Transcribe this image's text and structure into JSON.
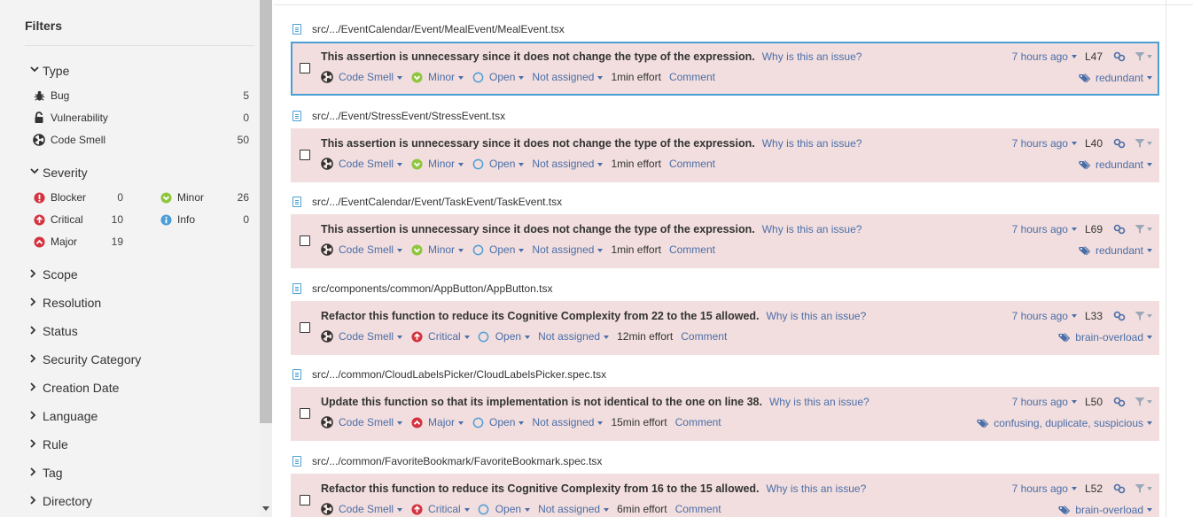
{
  "sidebar": {
    "title": "Filters",
    "type": {
      "label": "Type",
      "items": [
        {
          "label": "Bug",
          "count": "5",
          "icon": "bug-icon"
        },
        {
          "label": "Vulnerability",
          "count": "0",
          "icon": "lock-icon"
        },
        {
          "label": "Code Smell",
          "count": "50",
          "icon": "code-smell-icon"
        }
      ]
    },
    "severity": {
      "label": "Severity",
      "items": [
        {
          "label": "Blocker",
          "count": "0",
          "icon": "blocker-icon",
          "color": "#d4333f"
        },
        {
          "label": "Minor",
          "count": "26",
          "icon": "minor-icon",
          "color": "#8ec63f"
        },
        {
          "label": "Critical",
          "count": "10",
          "icon": "critical-icon",
          "color": "#d4333f"
        },
        {
          "label": "Info",
          "count": "0",
          "icon": "info-icon",
          "color": "#4b9fd5"
        },
        {
          "label": "Major",
          "count": "19",
          "icon": "major-icon",
          "color": "#d4333f"
        }
      ]
    },
    "collapsed": [
      "Scope",
      "Resolution",
      "Status",
      "Security Category",
      "Creation Date",
      "Language",
      "Rule",
      "Tag",
      "Directory"
    ]
  },
  "issues": [
    {
      "file": "src/.../EventCalendar/Event/MealEvent/MealEvent.tsx",
      "message": "This assertion is unnecessary since it does not change the type of the expression.",
      "why": "Why is this an issue?",
      "type": "Code Smell",
      "severity": "Minor",
      "status": "Open",
      "assignee": "Not assigned",
      "effort": "1min effort",
      "comment": "Comment",
      "ago": "7 hours ago",
      "line": "L47",
      "tags": "redundant"
    },
    {
      "file": "src/.../Event/StressEvent/StressEvent.tsx",
      "message": "This assertion is unnecessary since it does not change the type of the expression.",
      "why": "Why is this an issue?",
      "type": "Code Smell",
      "severity": "Minor",
      "status": "Open",
      "assignee": "Not assigned",
      "effort": "1min effort",
      "comment": "Comment",
      "ago": "7 hours ago",
      "line": "L40",
      "tags": "redundant"
    },
    {
      "file": "src/.../EventCalendar/Event/TaskEvent/TaskEvent.tsx",
      "message": "This assertion is unnecessary since it does not change the type of the expression.",
      "why": "Why is this an issue?",
      "type": "Code Smell",
      "severity": "Minor",
      "status": "Open",
      "assignee": "Not assigned",
      "effort": "1min effort",
      "comment": "Comment",
      "ago": "7 hours ago",
      "line": "L69",
      "tags": "redundant"
    },
    {
      "file": "src/components/common/AppButton/AppButton.tsx",
      "message": "Refactor this function to reduce its Cognitive Complexity from 22 to the 15 allowed.",
      "why": "Why is this an issue?",
      "type": "Code Smell",
      "severity": "Critical",
      "status": "Open",
      "assignee": "Not assigned",
      "effort": "12min effort",
      "comment": "Comment",
      "ago": "7 hours ago",
      "line": "L33",
      "tags": "brain-overload"
    },
    {
      "file": "src/.../common/CloudLabelsPicker/CloudLabelsPicker.spec.tsx",
      "message": "Update this function so that its implementation is not identical to the one on line 38.",
      "why": "Why is this an issue?",
      "type": "Code Smell",
      "severity": "Major",
      "status": "Open",
      "assignee": "Not assigned",
      "effort": "15min effort",
      "comment": "Comment",
      "ago": "7 hours ago",
      "line": "L50",
      "tags": "confusing, duplicate, suspicious"
    },
    {
      "file": "src/.../common/FavoriteBookmark/FavoriteBookmark.spec.tsx",
      "message": "Refactor this function to reduce its Cognitive Complexity from 16 to the 15 allowed.",
      "why": "Why is this an issue?",
      "type": "Code Smell",
      "severity": "Critical",
      "status": "Open",
      "assignee": "Not assigned",
      "effort": "6min effort",
      "comment": "Comment",
      "ago": "7 hours ago",
      "line": "L52",
      "tags": "brain-overload"
    }
  ]
}
